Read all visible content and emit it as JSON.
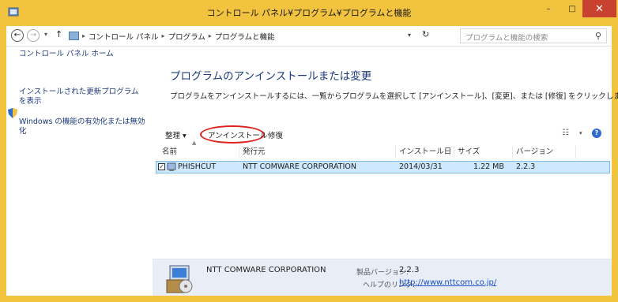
{
  "window": {
    "title": "コントロール パネル¥プログラム¥プログラムと機能",
    "minimize_glyph": "–",
    "maximize_glyph": "□",
    "close_glyph": "✕"
  },
  "address": {
    "segments": [
      "コントロール パネル",
      "プログラム",
      "プログラムと機能"
    ],
    "search_placeholder": "プログラムと機能の検索"
  },
  "sidebar": {
    "home": "コントロール パネル ホーム",
    "installed_updates": "インストールされた更新プログラムを表示",
    "windows_features": "Windows の機能の有効化または無効化"
  },
  "main": {
    "title": "プログラムのアンインストールまたは変更",
    "description": "プログラムをアンインストールするには、一覧からプログラムを選択して [アンインストール]、[変更]、または [修復] をクリックします。"
  },
  "toolbar": {
    "organize": "整理 ▾",
    "uninstall": "アンインストール",
    "repair": "修復"
  },
  "table": {
    "columns": [
      "名前",
      "発行元",
      "インストール日",
      "サイズ",
      "バージョン"
    ],
    "rows": [
      {
        "name": "PHISHCUT",
        "publisher": "NTT COMWARE CORPORATION",
        "install_date": "2014/03/31",
        "size": "1.22 MB",
        "version": "2.2.3"
      }
    ]
  },
  "details": {
    "company": "NTT COMWARE CORPORATION",
    "version_label": "製品バージョン:",
    "version": "2.2.3",
    "help_label": "ヘルプのリンク:",
    "help_link": "http://www.nttcom.co.jp/"
  },
  "colors": {
    "titlebar": "#f2c33f",
    "close": "#c7422f",
    "selection": "#cde8ff",
    "link": "#1c3a7a",
    "highlight_circle": "#e0201b"
  }
}
